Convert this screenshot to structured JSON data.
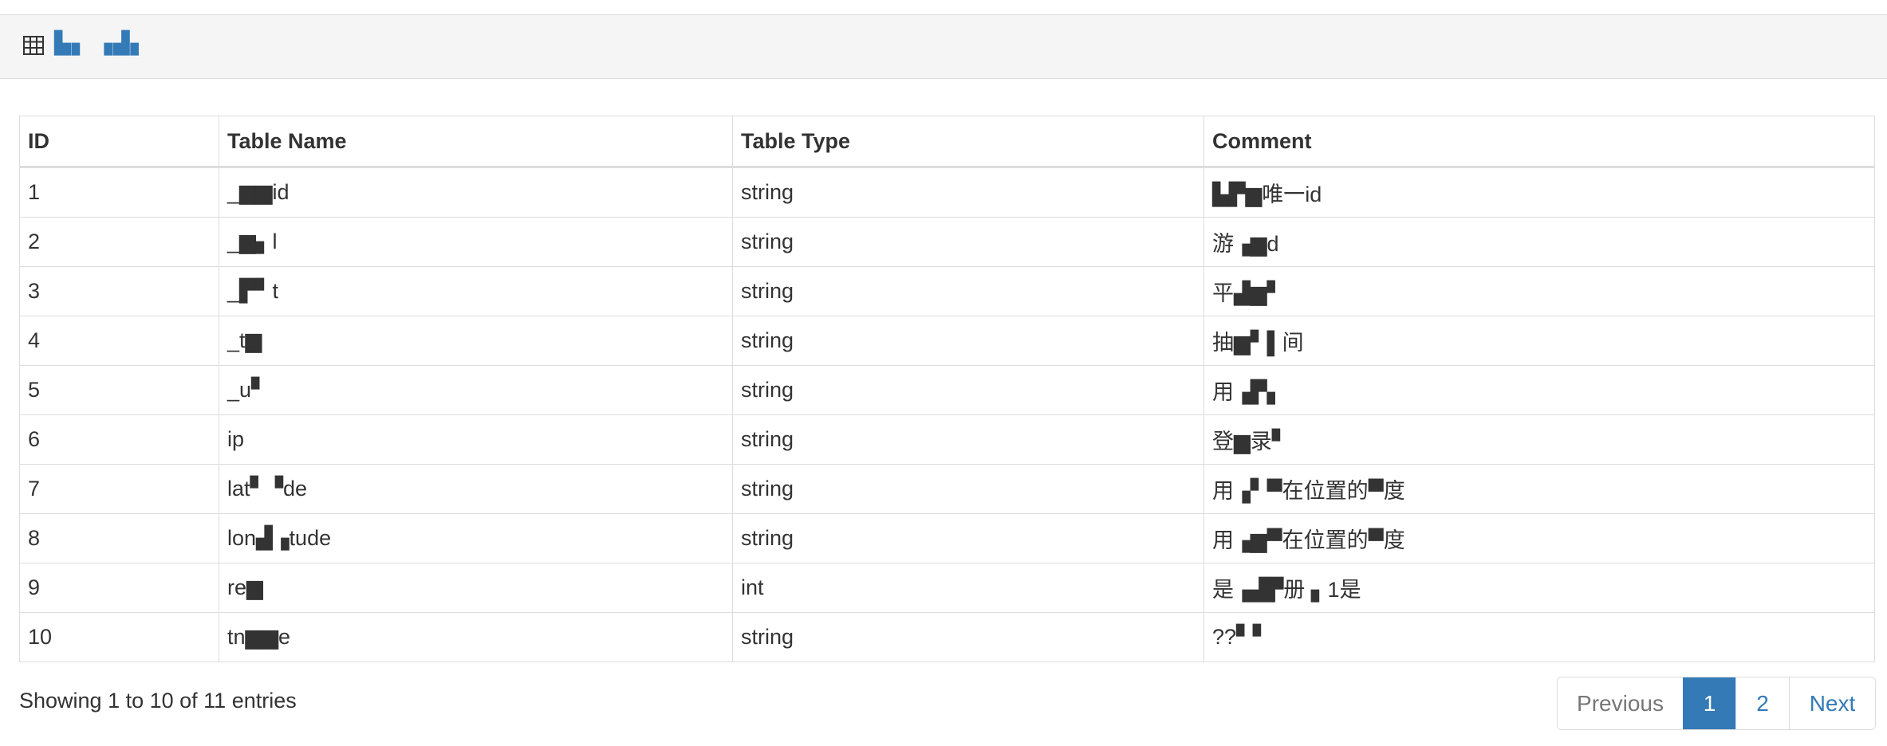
{
  "panel": {
    "icon": "table-icon",
    "title": "▙▖ ▗▟▖"
  },
  "table": {
    "headers": [
      "ID",
      "Table Name",
      "Table Type",
      "Comment"
    ],
    "rows": [
      [
        "1",
        "_▆▆id",
        "string",
        "▙▛▆唯一id"
      ],
      [
        "2",
        "_▆▖l",
        "string",
        "游▗▆d"
      ],
      [
        "3",
        "_▛▘t",
        "string",
        "平▟▆▘"
      ],
      [
        "4",
        "_t▆",
        "string",
        "抽▆▘▌间"
      ],
      [
        "5",
        "_u▘",
        "string",
        "用▗▛▖"
      ],
      [
        "6",
        "ip",
        "string",
        "登▆录▘"
      ],
      [
        "7",
        "lat▘▝de",
        "string",
        "用▗▘▀在位置的▀度"
      ],
      [
        "8",
        "lon▟▗tude",
        "string",
        "用▗▆▀在位置的▀度"
      ],
      [
        "9",
        "re▆",
        "int",
        "是▗▟▛册 ▖1是"
      ],
      [
        "10",
        "tn▆▆e",
        "string",
        "??▘▘"
      ]
    ]
  },
  "info": {
    "text": "Showing 1 to 10 of 11 entries"
  },
  "pagination": {
    "previous": "Previous",
    "page1": "1",
    "page2": "2",
    "next": "Next",
    "active_color": "#337ab7"
  }
}
